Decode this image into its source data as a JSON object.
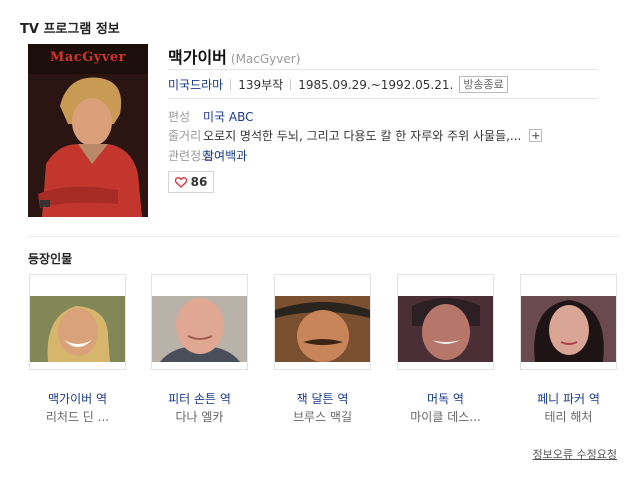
{
  "header": {
    "title": "TV 프로그램 정보"
  },
  "program": {
    "title": "맥가이버",
    "original_title": "(MacGyver)",
    "poster_logo": "MacGyver",
    "genre": "미국드라마",
    "episodes": "139부작",
    "period": "1985.09.29.~1992.05.21.",
    "status_badge": "방송종료",
    "network_label": "편성",
    "network": "미국 ABC",
    "synopsis_label": "줄거리",
    "synopsis": "오로지 명석한 두뇌, 그리고 다용도 칼 한 자루와 주위 사물들,...",
    "expand_symbol": "+",
    "related_label": "관련정보",
    "related_link": "참여백과",
    "likes": "86"
  },
  "cast": {
    "title": "등장인물",
    "items": [
      {
        "role": "맥가이버 역",
        "actor": "리처드 딘 ..."
      },
      {
        "role": "피터 손튼 역",
        "actor": "다나 엘카"
      },
      {
        "role": "잭 달튼 역",
        "actor": "브루스 맥길"
      },
      {
        "role": "머독 역",
        "actor": "마이클 데스..."
      },
      {
        "role": "페니 파커 역",
        "actor": "테리 해처"
      }
    ]
  },
  "footer": {
    "report_link": "정보오류 수정요청"
  },
  "icons": {
    "like": "heart-icon",
    "expand": "plus-icon"
  },
  "colors": {
    "link": "#1a3a8f",
    "heart": "#e0303a",
    "poster_logo": "#d0352a"
  }
}
